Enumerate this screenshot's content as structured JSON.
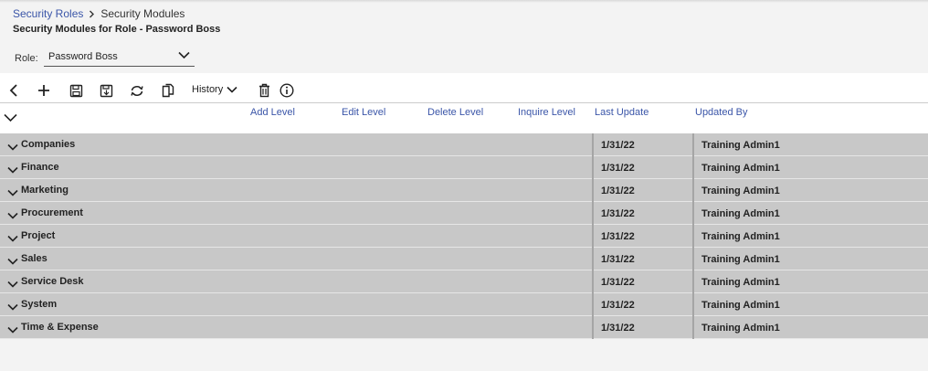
{
  "breadcrumb": {
    "parent": "Security Roles",
    "current": "Security Modules"
  },
  "page_title": "Security Modules for Role - Password Boss",
  "role": {
    "label": "Role:",
    "value": "Password Boss"
  },
  "toolbar": {
    "history_label": "History"
  },
  "columns": {
    "add_level": "Add Level",
    "edit_level": "Edit Level",
    "delete_level": "Delete Level",
    "inquire_level": "Inquire Level",
    "last_update": "Last Update",
    "updated_by": "Updated By"
  },
  "rows": [
    {
      "name": "Companies",
      "last_update": "1/31/22",
      "updated_by": "Training Admin1"
    },
    {
      "name": "Finance",
      "last_update": "1/31/22",
      "updated_by": "Training Admin1"
    },
    {
      "name": "Marketing",
      "last_update": "1/31/22",
      "updated_by": "Training Admin1"
    },
    {
      "name": "Procurement",
      "last_update": "1/31/22",
      "updated_by": "Training Admin1"
    },
    {
      "name": "Project",
      "last_update": "1/31/22",
      "updated_by": "Training Admin1"
    },
    {
      "name": "Sales",
      "last_update": "1/31/22",
      "updated_by": "Training Admin1"
    },
    {
      "name": "Service Desk",
      "last_update": "1/31/22",
      "updated_by": "Training Admin1"
    },
    {
      "name": "System",
      "last_update": "1/31/22",
      "updated_by": "Training Admin1"
    },
    {
      "name": "Time & Expense",
      "last_update": "1/31/22",
      "updated_by": "Training Admin1"
    }
  ],
  "colors": {
    "link": "#3a55a8",
    "row_bg": "#c8c8c8",
    "page_bg": "#f3f3f3"
  },
  "icons": [
    "back-icon",
    "plus-icon",
    "save-icon",
    "save-and-close-icon",
    "refresh-icon",
    "copy-icon",
    "chevron-down-icon",
    "trash-icon",
    "info-icon"
  ]
}
